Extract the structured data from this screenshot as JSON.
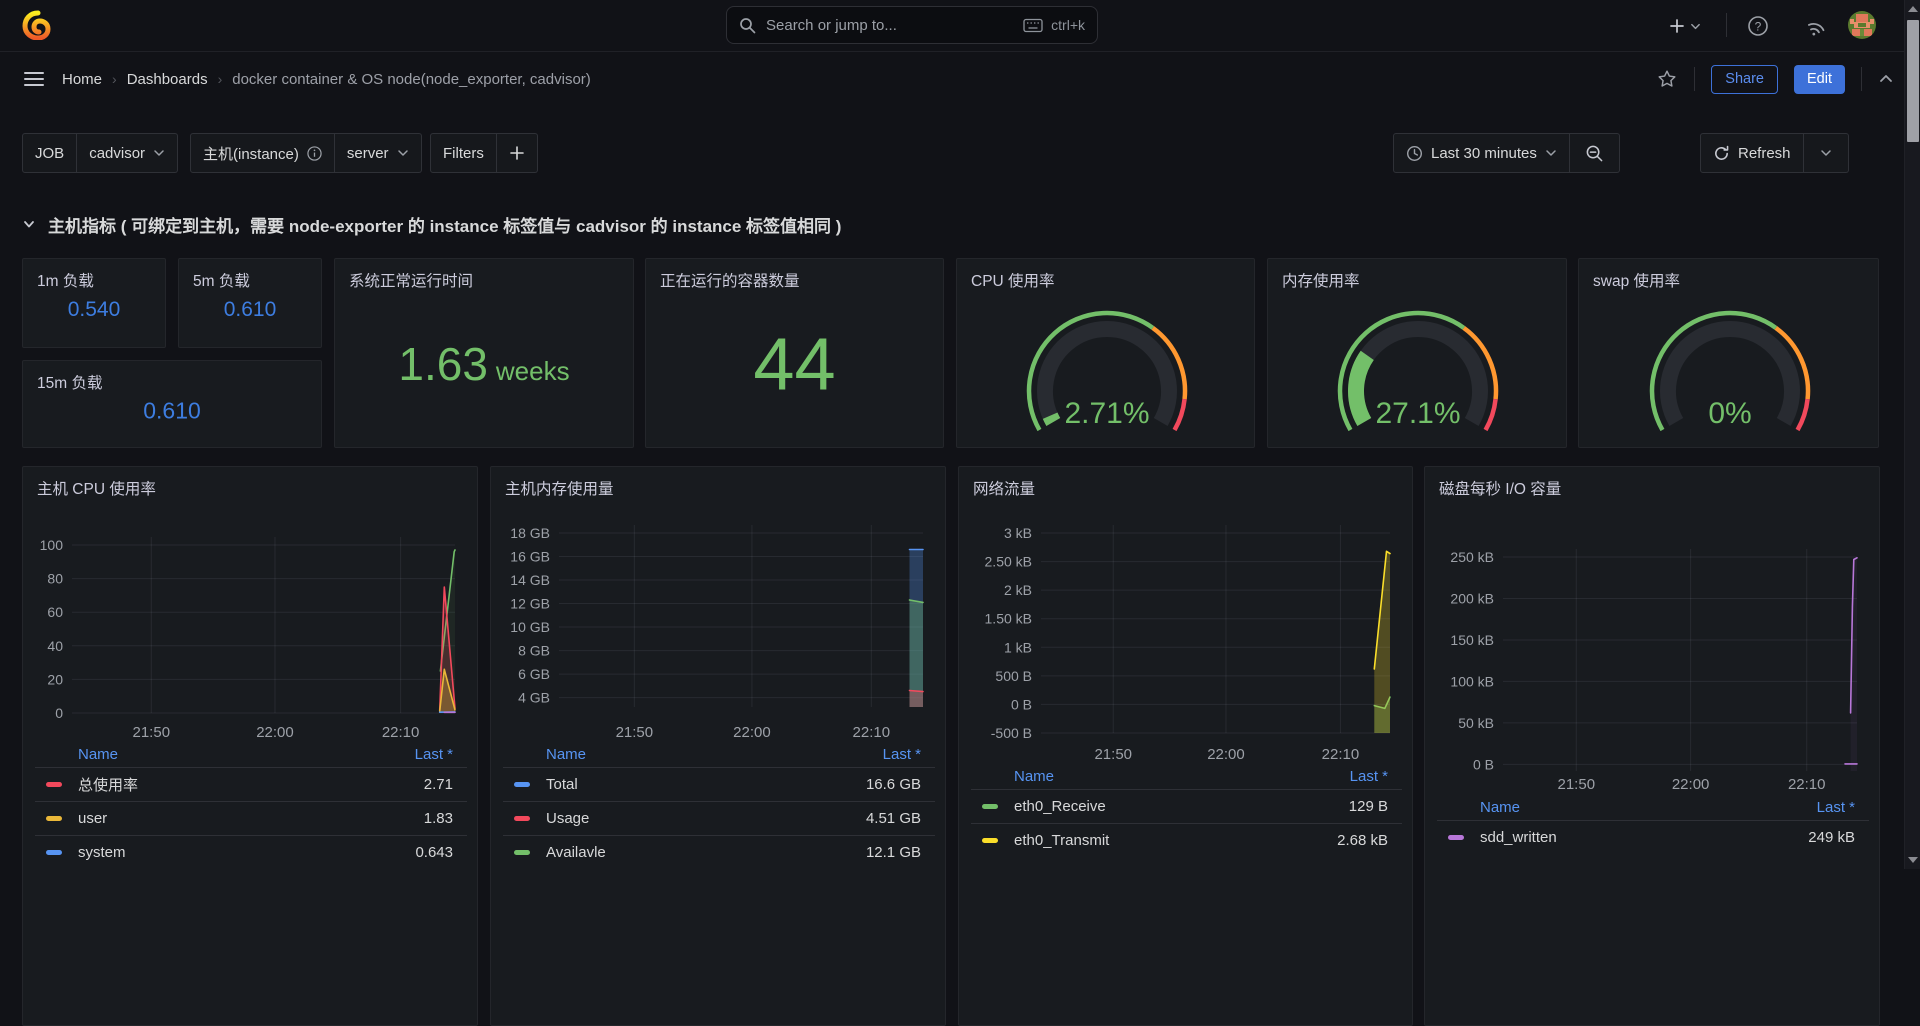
{
  "topnav": {
    "search": {
      "placeholder": "Search or jump to...",
      "shortcut": "ctrl+k"
    }
  },
  "breadcrumb": {
    "separator": "›",
    "items": [
      "Home",
      "Dashboards",
      "docker container & OS node(node_exporter, cadvisor)"
    ],
    "actions": {
      "share": "Share",
      "edit": "Edit"
    }
  },
  "toolbar": {
    "variables": [
      {
        "label": "JOB",
        "value": "cadvisor"
      },
      {
        "label": "主机(instance)",
        "value": "server"
      }
    ],
    "filters_label": "Filters",
    "time_range": "Last 30 minutes",
    "refresh_label": "Refresh"
  },
  "row_header": {
    "title": "主机指标 ( 可绑定到主机，需要 node-exporter 的 instance 标签值与 cadvisor 的 instance 标签值相同 )"
  },
  "stat_panels": [
    {
      "title": "1m 负载",
      "value": "0.540",
      "color": "#3D7DE0"
    },
    {
      "title": "5m 负载",
      "value": "0.610",
      "color": "#3D7DE0"
    },
    {
      "title": "15m 负载",
      "value": "0.610",
      "color": "#3D7DE0"
    },
    {
      "title": "系统正常运行时间",
      "value": "1.63",
      "unit": "weeks",
      "color": "#73BF69"
    },
    {
      "title": "正在运行的容器数量",
      "value": "44",
      "color": "#73BF69"
    }
  ],
  "gauge_panels": {
    "thresholds": [
      {
        "color": "#73BF69",
        "to": 65
      },
      {
        "color": "#FF9830",
        "to": 90
      },
      {
        "color": "#F2495C",
        "to": 100
      }
    ],
    "items": [
      {
        "title": "CPU 使用率",
        "value": 2.71,
        "display": "2.71%",
        "color": "#73BF69"
      },
      {
        "title": "内存使用率",
        "value": 27.1,
        "display": "27.1%",
        "color": "#73BF69"
      },
      {
        "title": "swap 使用率",
        "value": 0,
        "display": "0%",
        "color": "#73BF69"
      }
    ]
  },
  "chart_data": [
    {
      "type": "line",
      "title": "主机 CPU 使用率",
      "ylim": [
        0,
        100
      ],
      "yticks": [
        {
          "v": 0,
          "label": "0"
        },
        {
          "v": 20,
          "label": "20"
        },
        {
          "v": 40,
          "label": "40"
        },
        {
          "v": 60,
          "label": "60"
        },
        {
          "v": 80,
          "label": "80"
        },
        {
          "v": 100,
          "label": "100"
        }
      ],
      "xticks": [
        {
          "f": 0.207,
          "label": "21:50"
        },
        {
          "f": 0.53,
          "label": "22:00"
        },
        {
          "f": 0.858,
          "label": "22:10"
        }
      ],
      "series": [
        {
          "name": "",
          "legend": false,
          "color": "#73BF69",
          "fill": 0.08,
          "points": [
            [
              0.962,
              25
            ],
            [
              0.998,
              96
            ],
            [
              1,
              97
            ]
          ]
        },
        {
          "name": "总使用率",
          "color": "#F2495C",
          "fill": 0.2,
          "points": [
            [
              0.96,
              1.5
            ],
            [
              0.972,
              75
            ],
            [
              1,
              2.71
            ]
          ]
        },
        {
          "name": "user",
          "color": "#EAB839",
          "fill": 0.3,
          "points": [
            [
              0.96,
              1
            ],
            [
              0.972,
              26
            ],
            [
              1,
              1.83
            ]
          ]
        },
        {
          "name": "system",
          "color": "#5794F2",
          "fill": 0.35,
          "points": [
            [
              0.96,
              0.5
            ],
            [
              1,
              0.643
            ]
          ]
        },
        {
          "name": "",
          "legend": false,
          "color": "#B877D9",
          "fill": 0,
          "points": [
            [
              0.972,
              0.4
            ],
            [
              1,
              0.4
            ]
          ]
        }
      ],
      "legend": {
        "columns": [
          "Name",
          "Last *"
        ],
        "rows": [
          {
            "name": "总使用率",
            "value": "2.71",
            "color": "#F2495C"
          },
          {
            "name": "user",
            "value": "1.83",
            "color": "#EAB839"
          },
          {
            "name": "system",
            "value": "0.643",
            "color": "#5794F2"
          }
        ]
      }
    },
    {
      "type": "line",
      "title": "主机内存使用量",
      "ylim": [
        3.2,
        18
      ],
      "yticks": [
        {
          "v": 4,
          "label": "4 GB"
        },
        {
          "v": 6,
          "label": "6 GB"
        },
        {
          "v": 8,
          "label": "8 GB"
        },
        {
          "v": 10,
          "label": "10 GB"
        },
        {
          "v": 12,
          "label": "12 GB"
        },
        {
          "v": 14,
          "label": "14 GB"
        },
        {
          "v": 16,
          "label": "16 GB"
        },
        {
          "v": 18,
          "label": "18 GB"
        }
      ],
      "xticks": [
        {
          "f": 0.207,
          "label": "21:50"
        },
        {
          "f": 0.53,
          "label": "22:00"
        },
        {
          "f": 0.858,
          "label": "22:10"
        }
      ],
      "series": [
        {
          "name": "Total",
          "color": "#5794F2",
          "fill": 0.3,
          "points": [
            [
              0.963,
              16.6
            ],
            [
              1,
              16.6
            ]
          ]
        },
        {
          "name": "Availavle",
          "color": "#73BF69",
          "fill": 0.3,
          "points": [
            [
              0.963,
              12.3
            ],
            [
              1,
              12.1
            ]
          ]
        },
        {
          "name": "Usage",
          "color": "#F2495C",
          "fill": 0.3,
          "points": [
            [
              0.963,
              4.6
            ],
            [
              1,
              4.51
            ]
          ]
        }
      ],
      "legend": {
        "columns": [
          "Name",
          "Last *"
        ],
        "rows": [
          {
            "name": "Total",
            "value": "16.6 GB",
            "color": "#5794F2"
          },
          {
            "name": "Usage",
            "value": "4.51 GB",
            "color": "#F2495C"
          },
          {
            "name": "Availavle",
            "value": "12.1 GB",
            "color": "#73BF69"
          }
        ]
      }
    },
    {
      "type": "line",
      "title": "网络流量",
      "ylim": [
        -500,
        3000
      ],
      "yticks": [
        {
          "v": -500,
          "label": "-500 B"
        },
        {
          "v": 0,
          "label": "0 B"
        },
        {
          "v": 500,
          "label": "500 B"
        },
        {
          "v": 1000,
          "label": "1 kB"
        },
        {
          "v": 1500,
          "label": "1.50 kB"
        },
        {
          "v": 2000,
          "label": "2 kB"
        },
        {
          "v": 2500,
          "label": "2.50 kB"
        },
        {
          "v": 3000,
          "label": "3 kB"
        }
      ],
      "xticks": [
        {
          "f": 0.207,
          "label": "21:50"
        },
        {
          "f": 0.53,
          "label": "22:00"
        },
        {
          "f": 0.858,
          "label": "22:10"
        }
      ],
      "series": [
        {
          "name": "eth0_Receive",
          "color": "#73BF69",
          "fill": 0.25,
          "points": [
            [
              0.955,
              -20
            ],
            [
              0.985,
              -70
            ],
            [
              1,
              129
            ]
          ]
        },
        {
          "name": "eth0_Transmit",
          "color": "#FADE2A",
          "fill": 0.25,
          "points": [
            [
              0.955,
              620
            ],
            [
              0.99,
              2680
            ],
            [
              1,
              2640
            ]
          ]
        }
      ],
      "legend": {
        "columns": [
          "Name",
          "Last *"
        ],
        "rows": [
          {
            "name": "eth0_Receive",
            "value": "129 B",
            "color": "#73BF69"
          },
          {
            "name": "eth0_Transmit",
            "value": "2.68 kB",
            "color": "#FADE2A"
          }
        ]
      }
    },
    {
      "type": "line",
      "title": "磁盘每秒 I/O 容量",
      "ylim": [
        -8000,
        250000
      ],
      "yticks": [
        {
          "v": 0,
          "label": "0 B"
        },
        {
          "v": 50000,
          "label": "50 kB"
        },
        {
          "v": 100000,
          "label": "100 kB"
        },
        {
          "v": 150000,
          "label": "150 kB"
        },
        {
          "v": 200000,
          "label": "200 kB"
        },
        {
          "v": 250000,
          "label": "250 kB"
        }
      ],
      "xticks": [
        {
          "f": 0.207,
          "label": "21:50"
        },
        {
          "f": 0.53,
          "label": "22:00"
        },
        {
          "f": 0.858,
          "label": "22:10"
        }
      ],
      "series": [
        {
          "name": "",
          "legend": false,
          "color": "#B877D9",
          "fill": 0,
          "points": [
            [
              0.966,
              500
            ],
            [
              1,
              500
            ]
          ]
        },
        {
          "name": "sdd_written",
          "color": "#B877D9",
          "fill": 0.06,
          "points": [
            [
              0.982,
              62000
            ],
            [
              0.987,
              190000
            ],
            [
              0.991,
              247000
            ],
            [
              1,
              249000
            ]
          ]
        }
      ],
      "legend": {
        "columns": [
          "Name",
          "Last *"
        ],
        "rows": [
          {
            "name": "sdd_written",
            "value": "249 kB",
            "color": "#B877D9"
          }
        ]
      }
    }
  ]
}
